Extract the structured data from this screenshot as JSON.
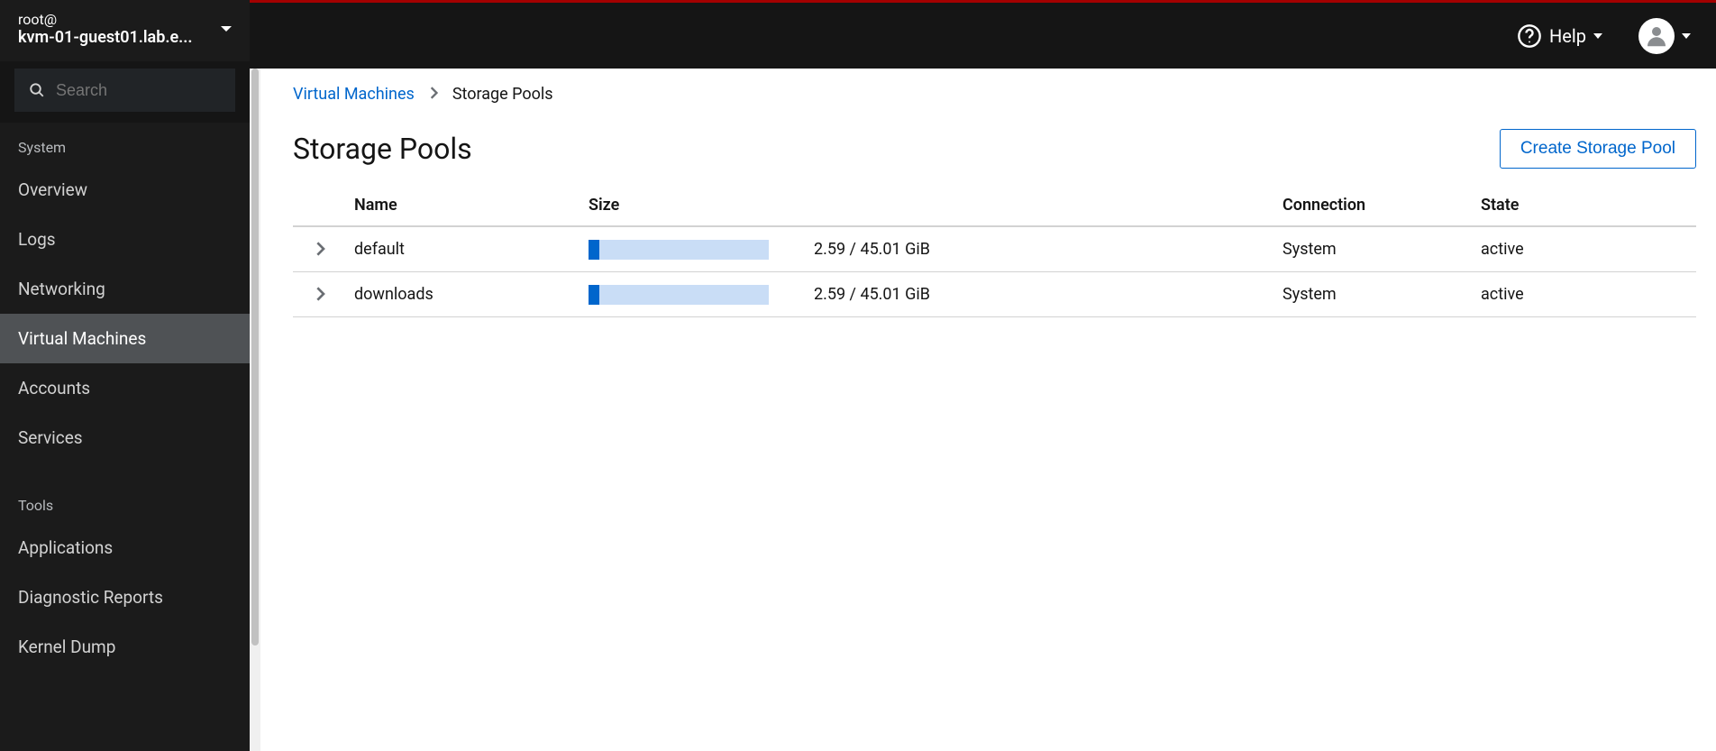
{
  "host": {
    "user": "root@",
    "name": "kvm-01-guest01.lab.e..."
  },
  "search": {
    "placeholder": "Search"
  },
  "sidebar": {
    "sections": [
      {
        "label": "System",
        "items": [
          "Overview",
          "Logs",
          "Networking",
          "Virtual Machines",
          "Accounts",
          "Services"
        ]
      },
      {
        "label": "Tools",
        "items": [
          "Applications",
          "Diagnostic Reports",
          "Kernel Dump"
        ]
      }
    ],
    "active": "Virtual Machines"
  },
  "topbar": {
    "help_label": "Help"
  },
  "breadcrumb": {
    "parent": "Virtual Machines",
    "current": "Storage Pools"
  },
  "page": {
    "title": "Storage Pools",
    "create_button": "Create Storage Pool"
  },
  "table": {
    "headers": {
      "name": "Name",
      "size": "Size",
      "connection": "Connection",
      "state": "State"
    },
    "rows": [
      {
        "name": "default",
        "used": 2.59,
        "total": 45.01,
        "unit": "GiB",
        "size_text": "2.59 / 45.01 GiB",
        "connection": "System",
        "state": "active"
      },
      {
        "name": "downloads",
        "used": 2.59,
        "total": 45.01,
        "unit": "GiB",
        "size_text": "2.59 / 45.01 GiB",
        "connection": "System",
        "state": "active"
      }
    ]
  }
}
